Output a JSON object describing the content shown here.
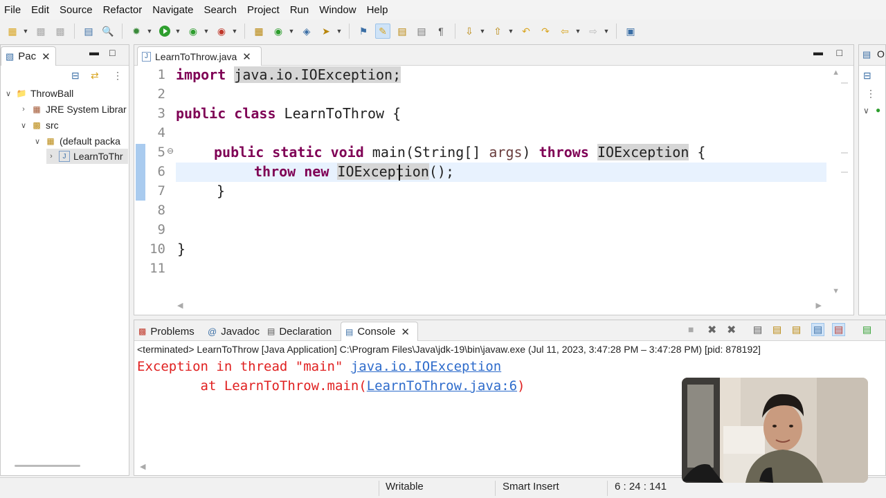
{
  "menu": [
    "File",
    "Edit",
    "Source",
    "Refactor",
    "Navigate",
    "Search",
    "Project",
    "Run",
    "Window",
    "Help"
  ],
  "package_explorer": {
    "tab_label": "Pac",
    "tree": [
      {
        "label": "ThrowBall",
        "icon": "project-icon",
        "expanded": true
      },
      {
        "label": "JRE System Librar",
        "icon": "library-icon",
        "expanded": false
      },
      {
        "label": "src",
        "icon": "source-folder-icon",
        "expanded": true
      },
      {
        "label": "(default packa",
        "icon": "package-icon",
        "expanded": true
      },
      {
        "label": "LearnToThr",
        "icon": "java-file-icon",
        "expanded": false
      }
    ]
  },
  "editor": {
    "tab_label": "LearnToThrow.java",
    "line_numbers": [
      "1",
      "2",
      "3",
      "4",
      "5",
      "6",
      "7",
      "8",
      "9",
      "10",
      "11"
    ],
    "code": {
      "l1_kw": "import",
      "l1_rest": "java.io.IOException;",
      "l3_kw": "public class",
      "l3_rest": " LearnToThrow {",
      "l5_kw1": "public static void",
      "l5_main": " main(String[] ",
      "l5_args": "args",
      "l5_close": ") ",
      "l5_kw2": "throws",
      "l5_exc": "IOException",
      "l5_brace": " {",
      "l6_kw": "throw new",
      "l6_exc": "IOException",
      "l6_rest": "();",
      "l7": "}",
      "l10": "}"
    },
    "cursor_position": "6 : 24 : 141"
  },
  "console": {
    "tabs": [
      "Problems",
      "Javadoc",
      "Declaration",
      "Console"
    ],
    "header": "<terminated> LearnToThrow [Java Application] C:\\Program Files\\Java\\jdk-19\\bin\\javaw.exe  (Jul 11, 2023, 3:47:28 PM – 3:47:28 PM) [pid: 878192]",
    "line1_text": "Exception in thread \"main\" ",
    "line1_link": "java.io.IOException",
    "line2_text": "        at LearnToThrow.main(",
    "line2_link": "LearnToThrow.java:6",
    "line2_end": ")"
  },
  "status_bar": {
    "mode": "Writable",
    "insert": "Smart Insert",
    "position": "6 : 24 : 141"
  },
  "colors": {
    "keyword": "#7f0055",
    "error": "#e02020",
    "link": "#2d6bcb",
    "current_line": "#e8f2fe"
  }
}
